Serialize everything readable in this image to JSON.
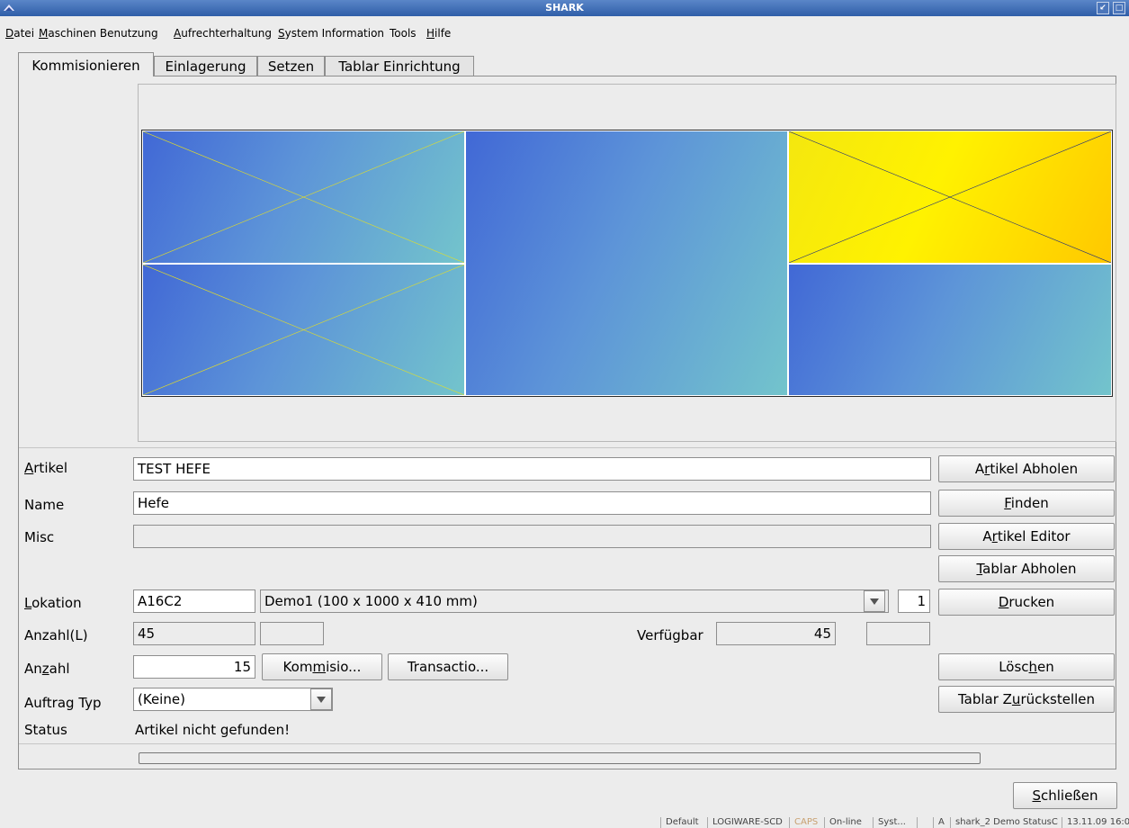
{
  "window": {
    "title": "SHARK",
    "btn_restore": "↙",
    "btn_close": "□"
  },
  "menu": {
    "datei_u": "D",
    "datei_rest": "atei",
    "maschinen_u": "M",
    "maschinen_rest": "aschinen Benutzung",
    "aufrecht_u": "A",
    "aufrecht_rest": "ufrechterhaltung",
    "system_u": "S",
    "system_rest": "ystem Information",
    "tools": "Tools",
    "hilfe_u": "H",
    "hilfe_rest": "ilfe"
  },
  "tabs": [
    "Kommisionieren",
    "Einlagerung",
    "Setzen",
    "Tablar Einrichtung"
  ],
  "form": {
    "artikel_label_u": "A",
    "artikel_label_rest": "rtikel",
    "artikel_value": "TEST HEFE",
    "name_label": "Name",
    "name_value": "Hefe",
    "misc_label": "Misc",
    "misc_value": "",
    "lokation_label_u": "L",
    "lokation_label_rest": "okation",
    "lokation_value": "A16C2",
    "tablar_select_value": "Demo1 (100 x 1000 x 410 mm)",
    "tablar_number": "1",
    "anzahl_l_label": "Anzahl(L)",
    "anzahl_l_value": "45",
    "anzahl_l_extra": "",
    "verfuegbar_label": "Verfügbar",
    "verfuegbar_value": "45",
    "verfuegbar_extra": "",
    "anzahl_label_pre": "An",
    "anzahl_label_u": "z",
    "anzahl_label_rest": "ahl",
    "anzahl_value": "15",
    "auftrag_label": "Auftrag Typ",
    "auftrag_value": "(Keine)",
    "status_label": "Status",
    "status_value": "Artikel nicht gefunden!"
  },
  "buttons": {
    "kommisio_pre": "Kom",
    "kommisio_u": "m",
    "kommisio_rest": "isio...",
    "transactio": "Transactio...",
    "artikel_abholen_pre": "A",
    "artikel_abholen_u": "r",
    "artikel_abholen_rest": "tikel Abholen",
    "finden_u": "F",
    "finden_rest": "inden",
    "artikel_editor_pre": "A",
    "artikel_editor_u": "r",
    "artikel_editor_rest": "tikel Editor",
    "tablar_abholen_u": "T",
    "tablar_abholen_rest": "ablar Abholen",
    "drucken_u": "D",
    "drucken_rest": "rucken",
    "loeschen_pre": "Lösc",
    "loeschen_u": "h",
    "loeschen_rest": "en",
    "tablar_zurueck_pre": "Tablar Z",
    "tablar_zurueck_u": "u",
    "tablar_zurueck_rest": "rückstellen",
    "schliessen_u": "S",
    "schliessen_rest": "chließen"
  },
  "progress_fraction": 0,
  "statusbar": [
    "Default",
    "LOGIWARE-SCD",
    "CAPS",
    "On-line",
    "Syst...",
    "",
    "A",
    "shark_2 Demo StatusC",
    "13.11.09 16:0"
  ],
  "colors": {
    "compartment_blue": "#4168d6",
    "compartment_teal": "#73c4cc",
    "compartment_yellow": "#fff200",
    "titlebar": "#2f5ea8",
    "caps_disabled": "#c8a070"
  }
}
